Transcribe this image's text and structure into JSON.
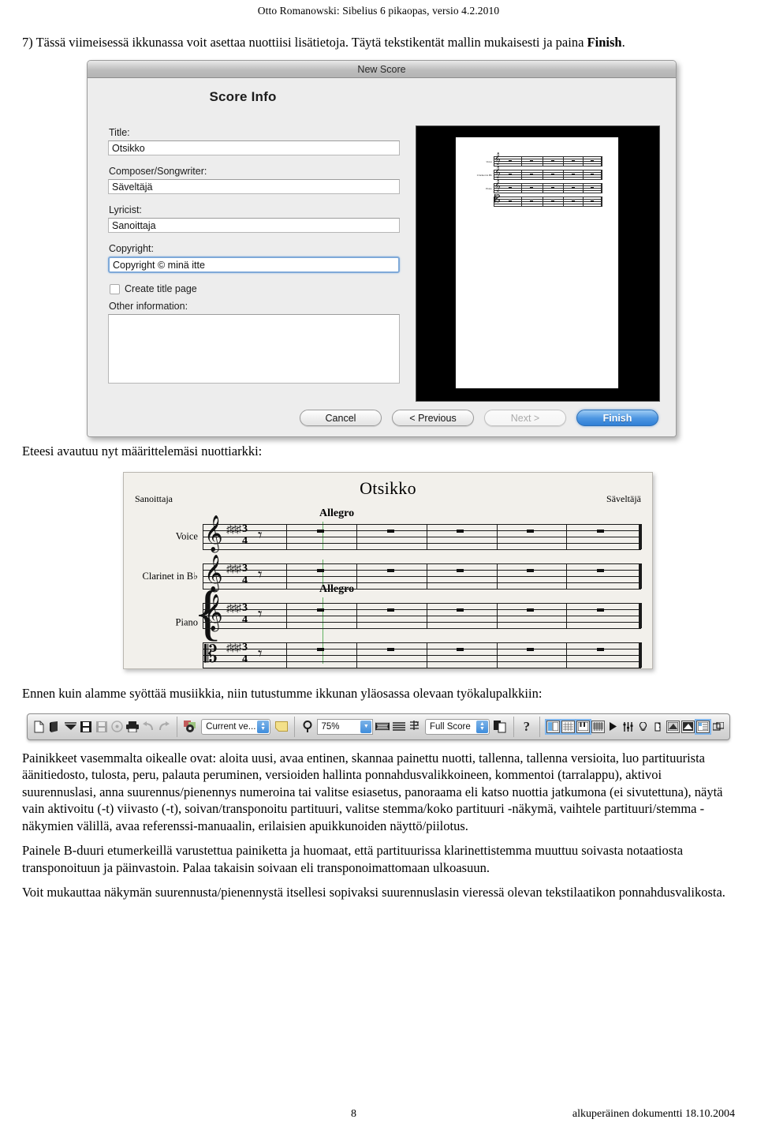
{
  "document": {
    "header": "Otto Romanowski: Sibelius 6 pikaopas, versio 4.2.2010",
    "step_text_a": "7) Tässä viimeisessä ikkunassa voit asettaa nuottiisi lisätietoja. Täytä tekstikentät mallin mukaisesti ja paina ",
    "step_text_bold": "Finish",
    "step_text_b": ".",
    "para_after_dialog": "Eteesi avautuu nyt määrittelemäsi nuottiarkki:",
    "para_before_toolbar": "Ennen kuin alamme syöttää musiikkia, niin tutustumme ikkunan yläosassa olevaan työkalupalkkiin:",
    "para_toolbar_desc": "Painikkeet vasemmalta oikealle ovat: aloita uusi, avaa entinen, skannaa painettu nuotti, tallenna, tallenna versioita, luo partituurista äänitiedosto, tulosta, peru, palauta peruminen, versioiden hallinta ponnahdusvalikkoineen, kommentoi (tarralappu), aktivoi suurennuslasi, anna suurennus/pienennys numeroina tai valitse esiasetus, panoraama eli katso nuottia jatkumona (ei sivutettuna), näytä vain aktivoitu (-t) viivasto (-t), soivan/transponoitu partituuri, valitse stemma/koko partituuri -näkymä, vaihtele partituuri/stemma -näkymien välillä, avaa referenssi-manuaalin, erilaisien apuikkunoiden näyttö/piilotus.",
    "para_bduuri": "Painele B-duuri etumerkeillä varustettua painiketta ja huomaat, että partituurissa klarinettistemma muuttuu soivasta notaatiosta transponoituun ja päinvastoin. Palaa takaisin soivaan eli transponoimattomaan ulkoasuun.",
    "para_zoom": "Voit mukauttaa näkymän suurennusta/pienennystä itsellesi sopivaksi suurennuslasin vieressä olevan tekstilaatikon ponnahdusvalikosta.",
    "footer_page": "8",
    "footer_note": "alkuperäinen dokumentti 18.10.2004"
  },
  "dialog": {
    "window_title": "New Score",
    "heading": "Score Info",
    "fields": [
      {
        "label": "Title:",
        "value": "Otsikko",
        "focused": false
      },
      {
        "label": "Composer/Songwriter:",
        "value": "Säveltäjä",
        "focused": false
      },
      {
        "label": "Lyricist:",
        "value": "Sanoittaja",
        "focused": false
      },
      {
        "label": "Copyright:",
        "value": "Copyright © minä itte",
        "focused": true
      }
    ],
    "checkbox": {
      "label": "Create title page",
      "checked": false
    },
    "other_information_label": "Other information:",
    "other_information_value": "",
    "buttons": [
      {
        "label": "Cancel",
        "state": "normal"
      },
      {
        "label": "< Previous",
        "state": "normal"
      },
      {
        "label": "Next >",
        "state": "disabled"
      },
      {
        "label": "Finish",
        "state": "default"
      }
    ],
    "preview_staff_names": [
      "Voice",
      "Clarinet in Bb",
      "Piano"
    ]
  },
  "score": {
    "title": "Otsikko",
    "lyricist": "Sanoittaja",
    "composer": "Säveltäjä",
    "tempo_marks": [
      "Allegro",
      "Allegro"
    ],
    "key_signature": "3 sharps",
    "time_signature_top": "3",
    "time_signature_bottom": "4",
    "bar_count": 6,
    "staves": [
      {
        "name": "Voice",
        "clef": "treble"
      },
      {
        "name": "Clarinet in B♭",
        "clef": "treble"
      },
      {
        "name": "Piano",
        "clef": "treble"
      },
      {
        "name": "",
        "clef": "bass"
      }
    ]
  },
  "toolbar": {
    "version_dropdown": "Current ve...",
    "zoom_value": "75%",
    "score_view_dropdown": "Full Score",
    "help_glyph": "?",
    "left_icons": [
      "new-score-icon",
      "open-score-icon",
      "scan-score-icon",
      "save-icon",
      "save-version-icon",
      "export-audio-icon",
      "print-icon",
      "undo-icon",
      "redo-icon"
    ],
    "mid_icons": [
      "versions-gear-icon",
      "comment-icon",
      "magnifier-icon"
    ],
    "right_icons": [
      "panorama-icon",
      "focus-on-staves-icon",
      "transposing-score-icon",
      "switch-parts-icon"
    ],
    "panel_icons": [
      "keypad-panel-icon",
      "navigator-panel-icon",
      "keyboard-panel-icon",
      "fretboard-panel-icon",
      "playback-panel-icon",
      "mixer-panel-icon",
      "ideas-panel-icon",
      "parts-panel-icon",
      "video-panel-icon",
      "transport-panel-icon",
      "comments-panel-icon",
      "windows-panel-icon"
    ]
  },
  "colors": {
    "accent_blue": "#3f8ddc",
    "default_button": "#4d96e2",
    "dialog_bg": "#ededec",
    "score_paper": "#f2f0eb",
    "green_playline": "#61b361"
  }
}
